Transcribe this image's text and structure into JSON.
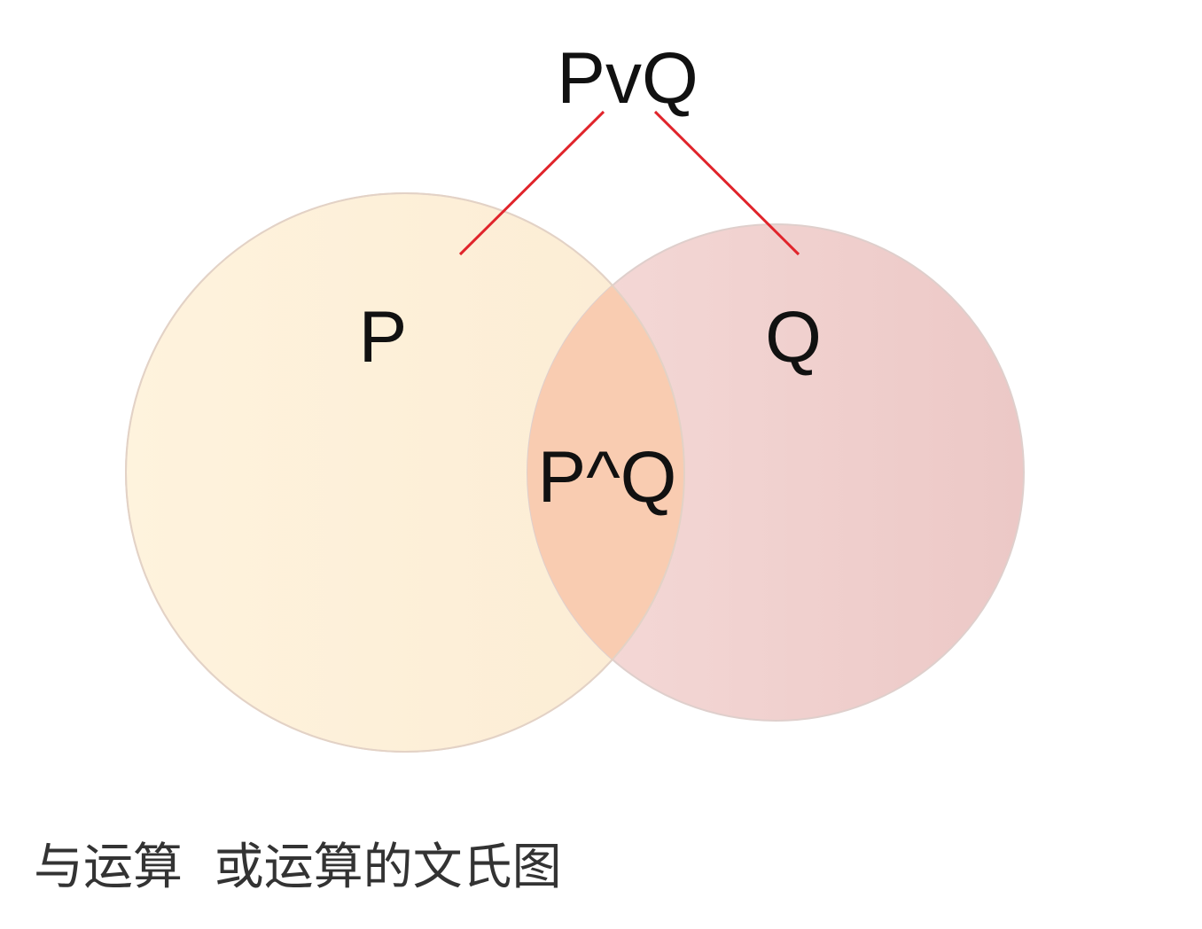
{
  "diagram": {
    "top_label": "PvQ",
    "left_set_label": "P",
    "right_set_label": "Q",
    "intersection_label": "P^Q",
    "colors": {
      "left_circle": "#fdefd6",
      "right_circle": "#efcccb",
      "intersection": "#f9ccb1",
      "circle_outline": "#e2d6cc",
      "connector_lines": "#e0242b",
      "label_text": "#111111"
    }
  },
  "caption": "与运算  或运算的文氏图"
}
